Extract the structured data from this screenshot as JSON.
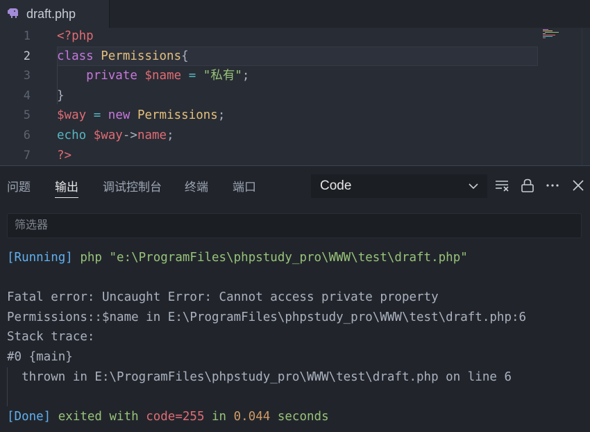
{
  "editor_tab": {
    "filename": "draft.php",
    "icon": "php-elephant-icon"
  },
  "editor": {
    "lines": [
      {
        "num": "1",
        "tokens": [
          {
            "t": "<?php",
            "c": "tag-red"
          }
        ]
      },
      {
        "num": "2",
        "tokens": [
          {
            "t": "class",
            "c": "kw-purple"
          },
          {
            "t": " ",
            "c": "plain"
          },
          {
            "t": "Permissions",
            "c": "cls-yellow"
          },
          {
            "t": "{",
            "c": "plain"
          }
        ]
      },
      {
        "num": "3",
        "tokens": [
          {
            "t": "    ",
            "c": "plain"
          },
          {
            "t": "private",
            "c": "kw-purple"
          },
          {
            "t": " ",
            "c": "plain"
          },
          {
            "t": "$name",
            "c": "var-red"
          },
          {
            "t": " ",
            "c": "plain"
          },
          {
            "t": "=",
            "c": "kw-cyan"
          },
          {
            "t": " ",
            "c": "plain"
          },
          {
            "t": "\"私有\"",
            "c": "str-green"
          },
          {
            "t": ";",
            "c": "plain"
          }
        ]
      },
      {
        "num": "4",
        "tokens": [
          {
            "t": "}",
            "c": "plain"
          }
        ]
      },
      {
        "num": "5",
        "tokens": [
          {
            "t": "$way",
            "c": "var-red"
          },
          {
            "t": " ",
            "c": "plain"
          },
          {
            "t": "=",
            "c": "kw-cyan"
          },
          {
            "t": " ",
            "c": "plain"
          },
          {
            "t": "new",
            "c": "kw-purple"
          },
          {
            "t": " ",
            "c": "plain"
          },
          {
            "t": "Permissions",
            "c": "cls-yellow"
          },
          {
            "t": ";",
            "c": "plain"
          }
        ]
      },
      {
        "num": "6",
        "tokens": [
          {
            "t": "echo",
            "c": "kw-cyan"
          },
          {
            "t": " ",
            "c": "plain"
          },
          {
            "t": "$way",
            "c": "var-red"
          },
          {
            "t": "->",
            "c": "plain"
          },
          {
            "t": "name",
            "c": "var-red"
          },
          {
            "t": ";",
            "c": "plain"
          }
        ]
      },
      {
        "num": "7",
        "tokens": [
          {
            "t": "?>",
            "c": "tag-red"
          }
        ]
      }
    ],
    "current_line": "2"
  },
  "panel": {
    "tabs": [
      {
        "label": "问题",
        "active": false
      },
      {
        "label": "输出",
        "active": true
      },
      {
        "label": "调试控制台",
        "active": false
      },
      {
        "label": "终端",
        "active": false
      },
      {
        "label": "端口",
        "active": false
      }
    ],
    "output_channel": "Code",
    "toolbar_icons": [
      "clear-output-icon",
      "lock-icon",
      "more-icon",
      "close-icon"
    ],
    "filter_placeholder": "筛选器",
    "output": [
      [
        {
          "t": "[Running]",
          "c": "o-blue"
        },
        {
          "t": " php \"e:\\ProgramFiles\\phpstudy_pro\\WWW\\test\\draft.php\"",
          "c": "o-green"
        }
      ],
      [],
      [
        {
          "t": "Fatal error: Uncaught Error: Cannot access private property",
          "c": "plain"
        }
      ],
      [
        {
          "t": "Permissions::$name in E:\\ProgramFiles\\phpstudy_pro\\WWW\\test\\draft.php:6",
          "c": "plain"
        }
      ],
      [
        {
          "t": "Stack trace:",
          "c": "plain"
        }
      ],
      [
        {
          "t": "#0 {main}",
          "c": "plain"
        }
      ],
      [
        {
          "t": "  thrown in E:\\ProgramFiles\\phpstudy_pro\\WWW\\test\\draft.php on line 6",
          "c": "plain"
        }
      ],
      [],
      [
        {
          "t": "[Done]",
          "c": "o-blue"
        },
        {
          "t": " exited with ",
          "c": "o-green"
        },
        {
          "t": "code=255",
          "c": "o-red"
        },
        {
          "t": " in ",
          "c": "o-green"
        },
        {
          "t": "0.044",
          "c": "o-yellow"
        },
        {
          "t": " seconds",
          "c": "o-green"
        }
      ]
    ]
  }
}
